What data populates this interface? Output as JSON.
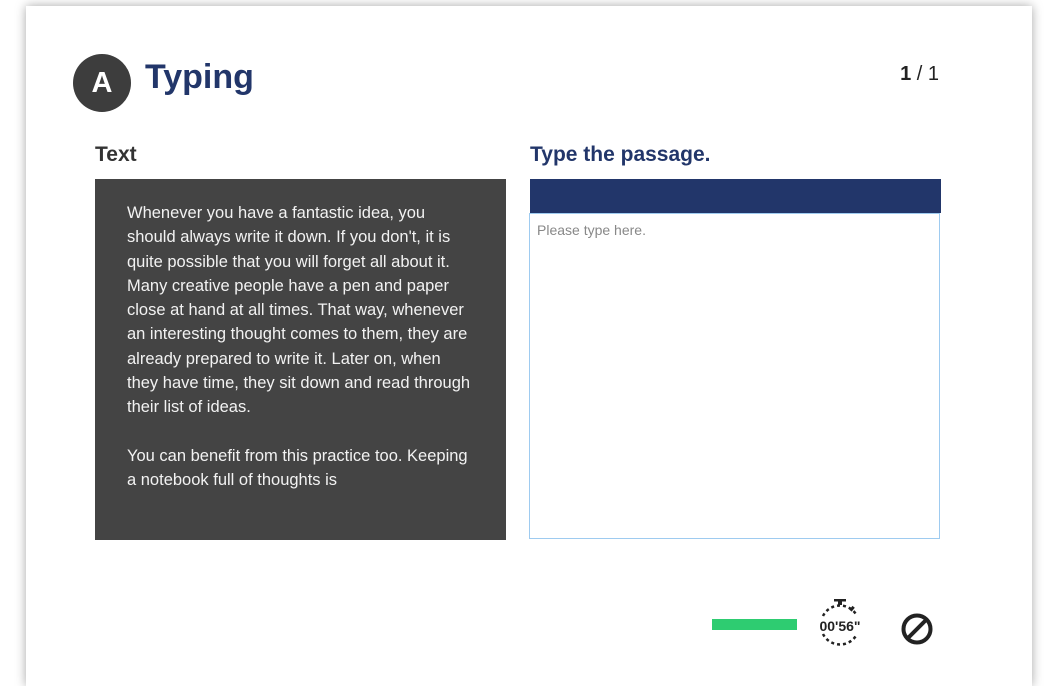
{
  "header": {
    "badge_letter": "A",
    "title": "Typing",
    "page_current": "1",
    "page_total": "1"
  },
  "left": {
    "heading": "Text",
    "paragraphs": [
      "Whenever you have a fantastic idea, you should always write it down. If you don't, it is quite possible that you will forget all about it. Many creative people have a pen and paper close at hand at all times. That way, whenever an interesting thought comes to them, they are already prepared to write it. Later on, when they have time, they sit down and read through their list of ideas.",
      "You can benefit from this practice too. Keeping a notebook full of thoughts is"
    ]
  },
  "right": {
    "heading": "Type the passage.",
    "input_value": "",
    "input_placeholder": "Please type here."
  },
  "footer": {
    "time_remaining_fraction": 1.0,
    "timer": "00'56\"",
    "icons": [
      "stopwatch-icon",
      "stop-icon"
    ]
  },
  "colors": {
    "accent_navy": "#22366a",
    "passage_bg": "#444444",
    "badge_bg": "#3d3d3d",
    "progress_green": "#2ecc71",
    "input_border": "#9ecbf0"
  }
}
